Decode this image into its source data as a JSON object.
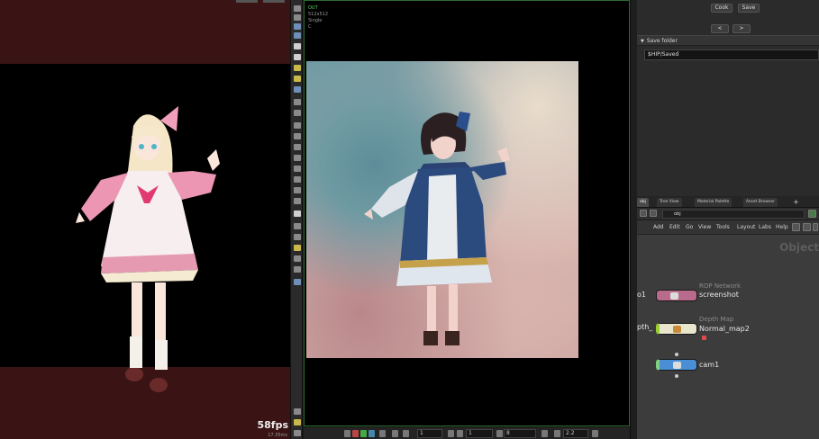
{
  "viewport_left": {
    "fps": "58fps",
    "frame_time": "17.35ms"
  },
  "render_view": {
    "info_lines": [
      "OUT",
      "512x512",
      "Single",
      "C"
    ],
    "statusbar": {
      "frame_start": "1",
      "frame_end": "1",
      "samples": "8",
      "gamma": "2.2"
    }
  },
  "parameters": {
    "cook_label": "Cook",
    "save_label": "Save",
    "prev_label": "<",
    "next_label": ">",
    "folder_label": "Save folder",
    "folder_value": "$HIP/Saved"
  },
  "network": {
    "tabs": [
      "obj",
      "Tree View",
      "Material Palette",
      "Asset Browser"
    ],
    "path": "obj",
    "menu": [
      "Add",
      "Edit",
      "Go",
      "View",
      "Tools",
      "Layout",
      "Labs",
      "Help"
    ],
    "context_title": "Object",
    "nodes": [
      {
        "type": "ROP Network",
        "name": "screenshot",
        "left_label": "o1",
        "color": "#b86b8a"
      },
      {
        "type": "Depth Map",
        "name": "Normal_map2",
        "left_label": "pth_",
        "color": "#e8e6cc"
      },
      {
        "type": "",
        "name": "cam1",
        "left_label": "",
        "color": "#4a8fd6"
      }
    ]
  },
  "colors": {
    "viewport_band": "#3a1414",
    "render_border": "#2e6b2e",
    "info_green": "#5fd35f"
  }
}
